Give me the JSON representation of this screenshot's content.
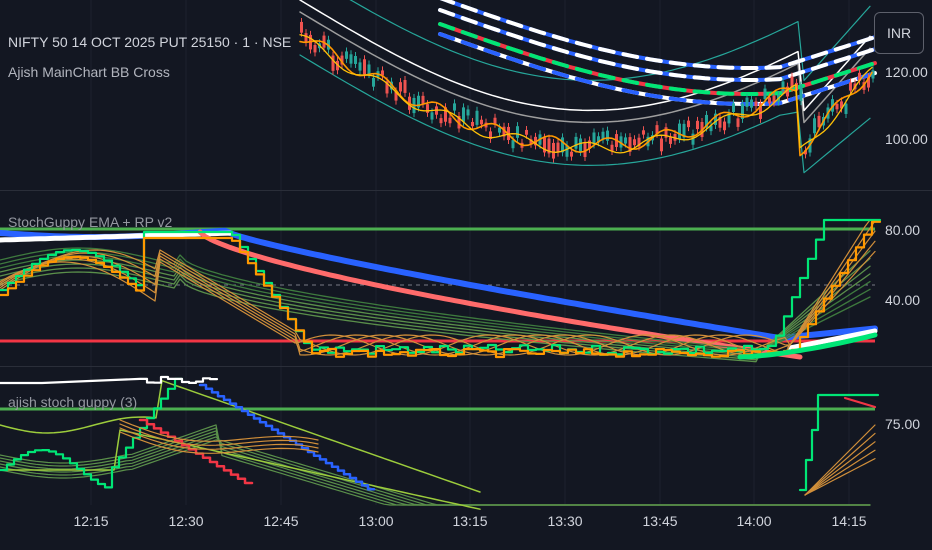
{
  "header": {
    "symbol_title": "NIFTY 50 14 OCT 2025 PUT 25150 · 1 · NSE",
    "indicator_main": "Ajish MainChart BB Cross"
  },
  "currency_button": {
    "label": "INR"
  },
  "panes": {
    "price": {
      "labels": [
        "120.00",
        "100.00"
      ]
    },
    "stoch_guppy": {
      "title": "StochGuppy EMA + RP v2",
      "labels": [
        "80.00",
        "40.00"
      ]
    },
    "ajish_stoch": {
      "title": "ajish stoch guppy (3)",
      "labels": [
        "75.00"
      ]
    }
  },
  "time_axis": {
    "labels": [
      "12:15",
      "12:30",
      "12:45",
      "13:00",
      "13:15",
      "13:30",
      "13:45",
      "14:00",
      "14:15"
    ]
  },
  "colors": {
    "background": "#131722",
    "up_candle": "#26a69a",
    "down_candle": "#ef5350",
    "green_line": "#4caf50",
    "red_line": "#f23645",
    "blue_line": "#2962ff",
    "orange": "#ff9800",
    "bright_green": "#00e676"
  }
}
